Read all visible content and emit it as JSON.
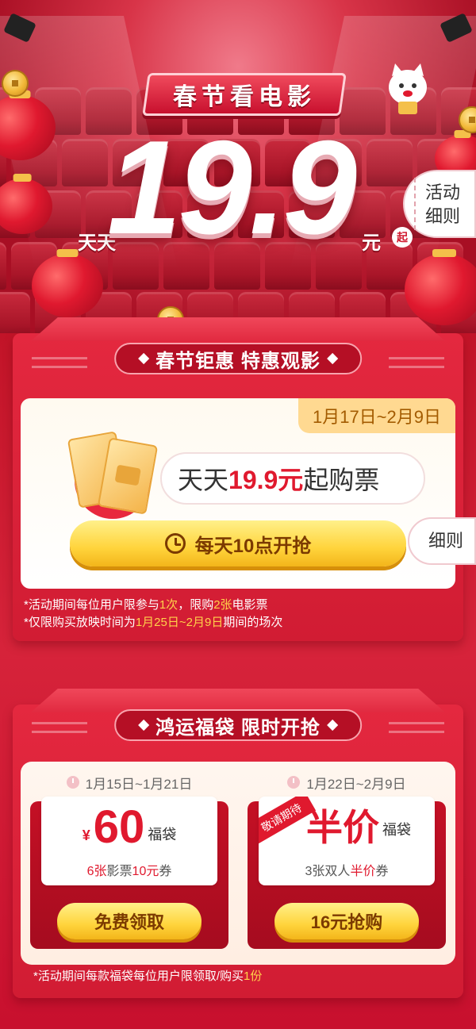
{
  "hero": {
    "title": "春节看电影",
    "prefix": "天天",
    "price": "19.9",
    "unit": "元",
    "qi": "起",
    "rules_line1": "活动",
    "rules_line2": "细则"
  },
  "section1": {
    "header": "春节钜惠 特惠观影",
    "date_range": "1月17日~2月9日",
    "buy_text_prefix": "天天",
    "buy_text_highlight": "19.9元",
    "buy_text_suffix": "起购票",
    "button_label": "每天10点开抢",
    "rules_label": "细则",
    "note1_a": "*活动期间每位用户限参与",
    "note1_b": "1次",
    "note1_c": "，限购",
    "note1_d": "2张",
    "note1_e": "电影票",
    "note2_a": "*仅限购买放映时间为",
    "note2_b": "1月25日~2月9日",
    "note2_c": "期间的场次"
  },
  "section2": {
    "header": "鸿运福袋  限时开抢",
    "bag1": {
      "date": "1月15日~1月21日",
      "currency": "¥",
      "amount": "60",
      "unit": "福袋",
      "desc_a": "6张",
      "desc_b": "影票",
      "desc_c": "10元",
      "desc_d": "券",
      "button": "免费领取"
    },
    "bag2": {
      "date": "1月22日~2月9日",
      "ribbon": "敬请期待",
      "amount": "半价",
      "unit": "福袋",
      "desc_a": "3张双人",
      "desc_b": "半价",
      "desc_c": "券",
      "button": "16元抢购"
    },
    "note_a": "*活动期间每款福袋每位用户限领取/购买",
    "note_b": "1份"
  },
  "colors": {
    "primary_red": "#d11c33",
    "gold": "#ffd43c",
    "highlight_yellow": "#ffd24a"
  }
}
